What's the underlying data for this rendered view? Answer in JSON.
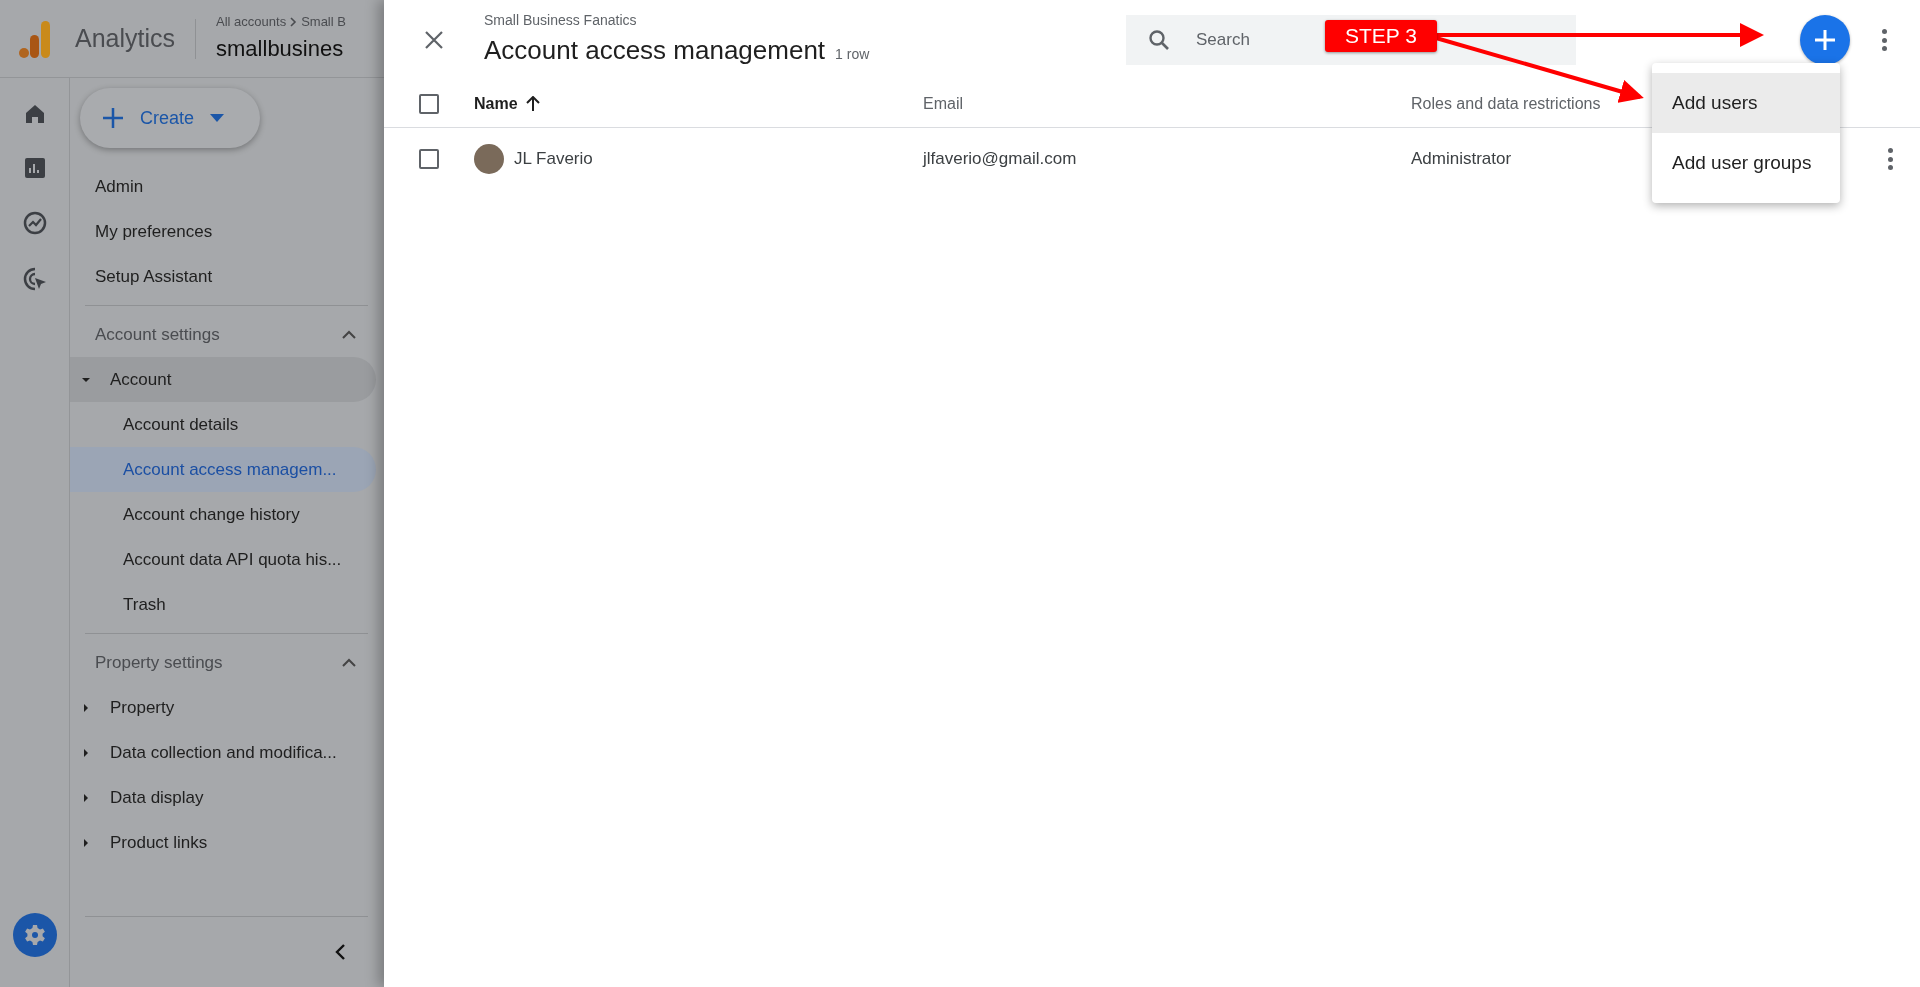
{
  "app": {
    "name": "Analytics",
    "breadcrumb": [
      "All accounts",
      "Small B"
    ],
    "account_name": "smallbusines"
  },
  "create_button": {
    "label": "Create"
  },
  "nav_items": [
    {
      "label": "Admin"
    },
    {
      "label": "My preferences"
    },
    {
      "label": "Setup Assistant"
    }
  ],
  "sections": [
    {
      "title": "Account settings",
      "expanded": true,
      "items": [
        {
          "label": "Account",
          "expanded": true,
          "children": [
            {
              "label": "Account details",
              "selected": false
            },
            {
              "label": "Account access managem...",
              "selected": true
            },
            {
              "label": "Account change history",
              "selected": false
            },
            {
              "label": "Account data API quota his...",
              "selected": false
            },
            {
              "label": "Trash",
              "selected": false
            }
          ]
        }
      ]
    },
    {
      "title": "Property settings",
      "expanded": true,
      "items": [
        {
          "label": "Property",
          "expanded": false
        },
        {
          "label": "Data collection and modifica...",
          "expanded": false
        },
        {
          "label": "Data display",
          "expanded": false
        },
        {
          "label": "Product links",
          "expanded": false
        }
      ]
    }
  ],
  "panel": {
    "context": "Small Business Fanatics",
    "title": "Account access management",
    "row_count": "1 row",
    "search": {
      "placeholder": "Search"
    },
    "header_checkbox": {
      "checked": false
    },
    "columns": [
      {
        "label": "Name",
        "sorted": true
      },
      {
        "label": "Email",
        "sorted": false
      },
      {
        "label": "Roles and data restrictions",
        "sorted": false
      }
    ],
    "rows": [
      {
        "name": "JL Faverio",
        "email": "jlfaverio@gmail.com",
        "role": "Administrator",
        "checked": false
      }
    ],
    "menu": [
      {
        "label": "Add users",
        "selected": true
      },
      {
        "label": "Add user groups",
        "selected": false
      }
    ]
  },
  "annotation": {
    "label": "STEP 3"
  }
}
